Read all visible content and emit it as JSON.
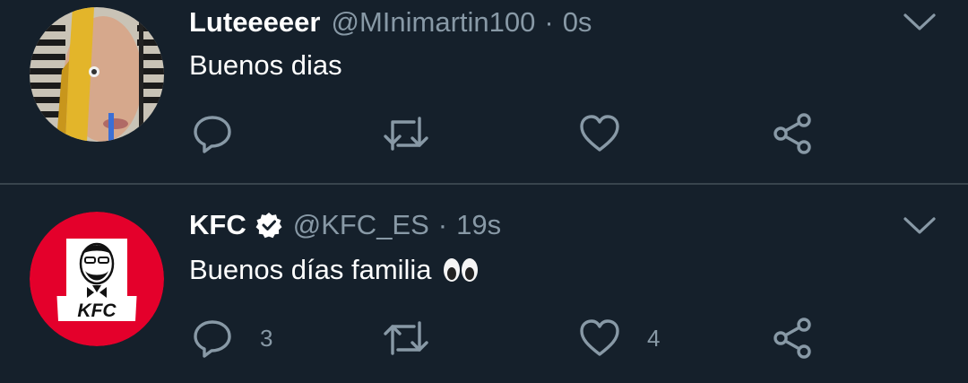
{
  "colors": {
    "background": "#15202b",
    "divider": "#38444d",
    "text_primary": "#ffffff",
    "text_secondary": "#8899a6",
    "kfc_red": "#e4002b"
  },
  "icons": {
    "reply": "speech-bubble",
    "retweet": "two-arrows-square",
    "like": "heart-outline",
    "share": "share-nodes",
    "more": "chevron-down",
    "verified": "verified-badge"
  },
  "tweets": [
    {
      "display_name": "Luteeeeer",
      "handle": "@MInimartin100",
      "separator": "·",
      "time": "0s",
      "text": "Buenos dias",
      "verified": false,
      "reply_count": "",
      "like_count": ""
    },
    {
      "display_name": "KFC",
      "handle": "@KFC_ES",
      "separator": "·",
      "time": "19s",
      "text": "Buenos días familia",
      "verified": true,
      "emoji": "eyes",
      "reply_count": "3",
      "like_count": "4",
      "avatar_logo_text": "KFC"
    }
  ]
}
